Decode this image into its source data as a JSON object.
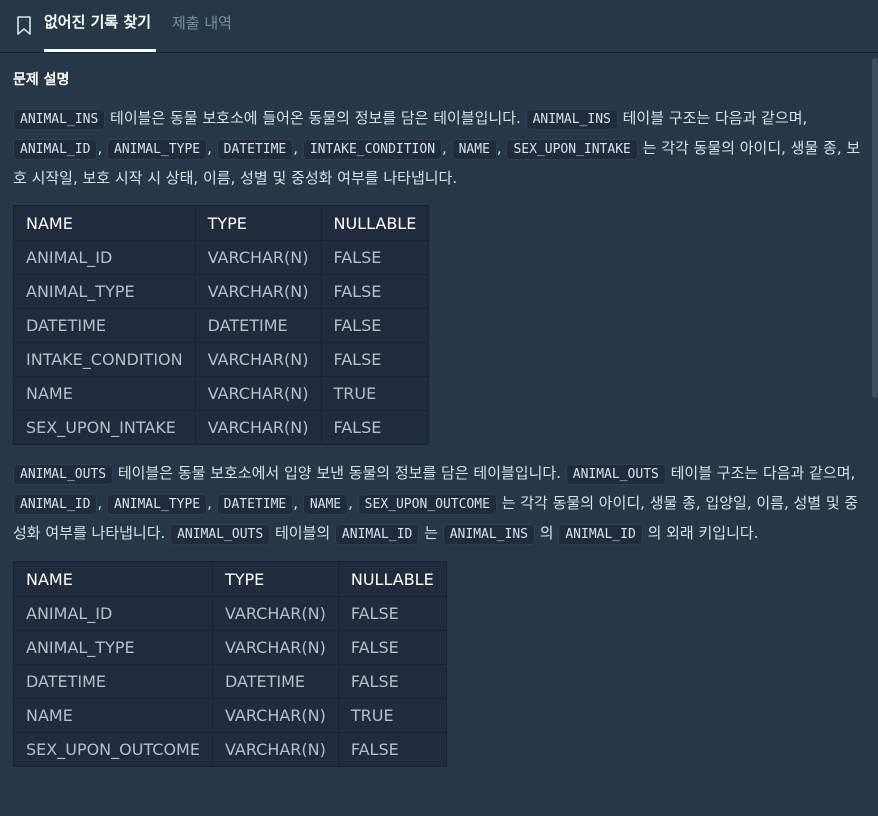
{
  "tabs": {
    "active": "없어진 기록 찾기",
    "inactive": "제출 내역"
  },
  "section_title": "문제 설명",
  "para1": {
    "c1": "ANIMAL_INS",
    "t1": " 테이블은 동물 보호소에 들어온 동물의 정보를 담은 테이블입니다. ",
    "c2": "ANIMAL_INS",
    "t2": " 테이블 구조는 다음과 같으며, ",
    "c3": "ANIMAL_ID",
    "t3": ", ",
    "c4": "ANIMAL_TYPE",
    "t4": ", ",
    "c5": "DATETIME",
    "t5": ", ",
    "c6": "INTAKE_CONDITION",
    "t6": ", ",
    "c7": "NAME",
    "t7": ", ",
    "c8": "SEX_UPON_INTAKE",
    "t8": " 는 각각 동물의 아이디, 생물 종, 보호 시작일, 보호 시작 시 상태, 이름, 성별 및 중성화 여부를 나타냅니다."
  },
  "table1": {
    "headers": [
      "NAME",
      "TYPE",
      "NULLABLE"
    ],
    "rows": [
      [
        "ANIMAL_ID",
        "VARCHAR(N)",
        "FALSE"
      ],
      [
        "ANIMAL_TYPE",
        "VARCHAR(N)",
        "FALSE"
      ],
      [
        "DATETIME",
        "DATETIME",
        "FALSE"
      ],
      [
        "INTAKE_CONDITION",
        "VARCHAR(N)",
        "FALSE"
      ],
      [
        "NAME",
        "VARCHAR(N)",
        "TRUE"
      ],
      [
        "SEX_UPON_INTAKE",
        "VARCHAR(N)",
        "FALSE"
      ]
    ]
  },
  "para2": {
    "c1": "ANIMAL_OUTS",
    "t1": " 테이블은 동물 보호소에서 입양 보낸 동물의 정보를 담은 테이블입니다. ",
    "c2": "ANIMAL_OUTS",
    "t2": " 테이블 구조는 다음과 같으며, ",
    "c3": "ANIMAL_ID",
    "t3": ", ",
    "c4": "ANIMAL_TYPE",
    "t4": ", ",
    "c5": "DATETIME",
    "t5": ", ",
    "c6": "NAME",
    "t6": ", ",
    "c7": "SEX_UPON_OUTCOME",
    "t7": " 는 각각 동물의 아이디, 생물 종, 입양일, 이름, 성별 및 중성화 여부를 나타냅니다. ",
    "c8": "ANIMAL_OUTS",
    "t8": " 테이블의 ",
    "c9": "ANIMAL_ID",
    "t9": " 는 ",
    "c10": "ANIMAL_INS",
    "t10": " 의 ",
    "c11": "ANIMAL_ID",
    "t11": " 의 외래 키입니다."
  },
  "table2": {
    "headers": [
      "NAME",
      "TYPE",
      "NULLABLE"
    ],
    "rows": [
      [
        "ANIMAL_ID",
        "VARCHAR(N)",
        "FALSE"
      ],
      [
        "ANIMAL_TYPE",
        "VARCHAR(N)",
        "FALSE"
      ],
      [
        "DATETIME",
        "DATETIME",
        "FALSE"
      ],
      [
        "NAME",
        "VARCHAR(N)",
        "TRUE"
      ],
      [
        "SEX_UPON_OUTCOME",
        "VARCHAR(N)",
        "FALSE"
      ]
    ]
  }
}
